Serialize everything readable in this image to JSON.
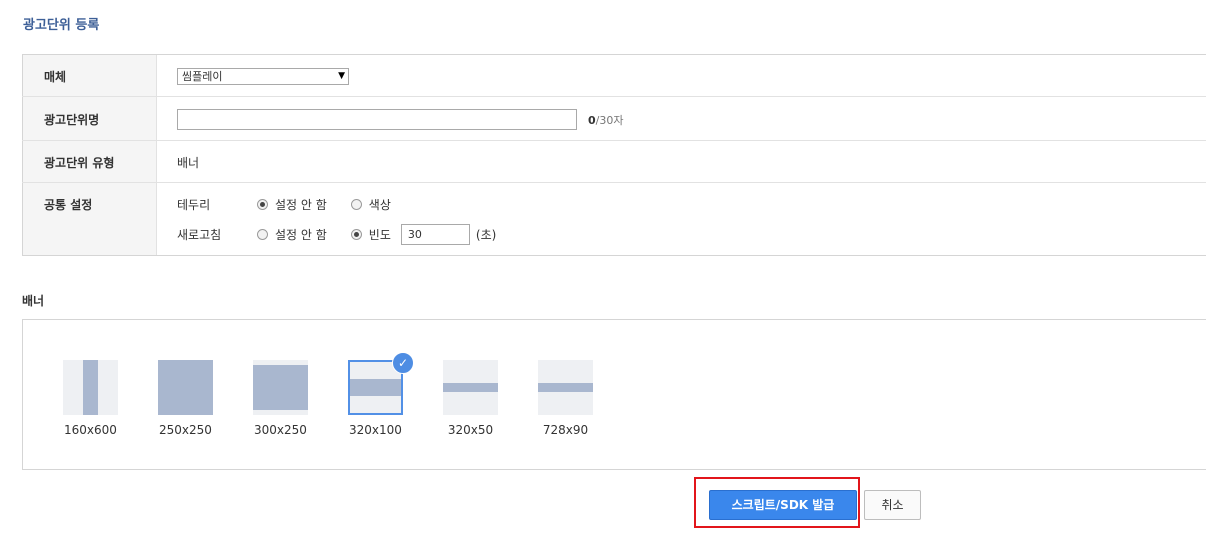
{
  "page_title": "광고단위 등록",
  "form": {
    "media": {
      "label": "매체",
      "selected": "씸플레이"
    },
    "ad_unit_name": {
      "label": "광고단위명",
      "value": "",
      "counter_current": "0",
      "counter_suffix": "/30자"
    },
    "ad_unit_type": {
      "label": "광고단위 유형",
      "value": "배너"
    },
    "common_settings": {
      "label": "공통 설정",
      "border": {
        "label": "테두리",
        "options": [
          "설정 안 함",
          "색상"
        ],
        "selected": "설정 안 함"
      },
      "refresh": {
        "label": "새로고침",
        "options": [
          "설정 안 함",
          "빈도"
        ],
        "selected": "빈도",
        "frequency_value": "30",
        "unit": "(초)"
      }
    }
  },
  "banner_section": {
    "title": "배너",
    "sizes": [
      "160x600",
      "250x250",
      "300x250",
      "320x100",
      "320x50",
      "728x90"
    ],
    "selected": "320x100"
  },
  "actions": {
    "issue_label": "스크립트/SDK 발급",
    "cancel_label": "취소"
  },
  "colors": {
    "accent": "#3a87ec",
    "title": "#3d5f97",
    "highlight": "#e2151b"
  }
}
